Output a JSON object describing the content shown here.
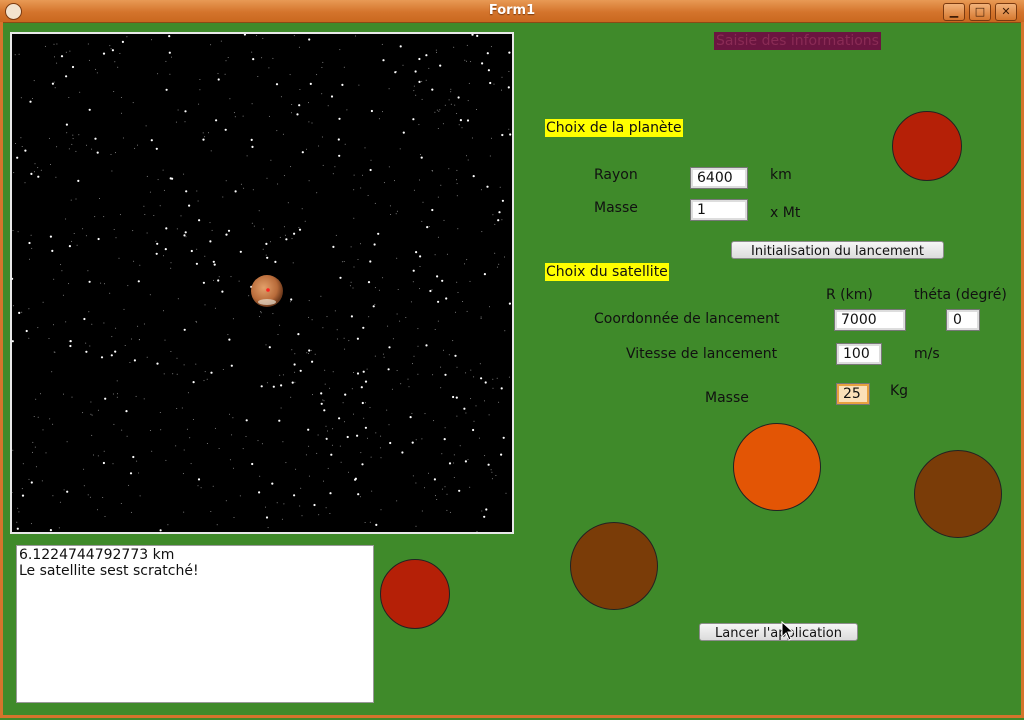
{
  "window": {
    "title": "Form1",
    "buttons": {
      "minimize": "▁",
      "maximize": "□",
      "close": "✕"
    }
  },
  "header": {
    "title": "Saisie des informations"
  },
  "planet": {
    "section_label": "Choix de la planète",
    "rayon_label": "Rayon",
    "rayon_value": "6400",
    "rayon_unit": "km",
    "masse_label": "Masse",
    "masse_value": "1",
    "masse_unit": "x Mt",
    "init_button": "Initialisation du lancement"
  },
  "satellite": {
    "section_label": "Choix du satellite",
    "r_header": "R (km)",
    "theta_header": "théta (degré)",
    "coord_label": "Coordonnée de lancement",
    "coord_r": "7000",
    "coord_theta": "0",
    "vitesse_label": "Vitesse de lancement",
    "vitesse_value": "100",
    "vitesse_unit": "m/s",
    "masse_label": "Masse",
    "masse_value": "25",
    "masse_unit": "Kg"
  },
  "launch_button": "Lancer l'application",
  "log": {
    "line1": "6.1224744792773  km",
    "line2": "Le satellite sest scratché!"
  },
  "colors": {
    "background": "#3f8a2a",
    "red": "#b52007",
    "orange": "#e35505",
    "brown": "#7a3c08",
    "highlight": "#ffff00",
    "header_bg": "#6b1540"
  }
}
